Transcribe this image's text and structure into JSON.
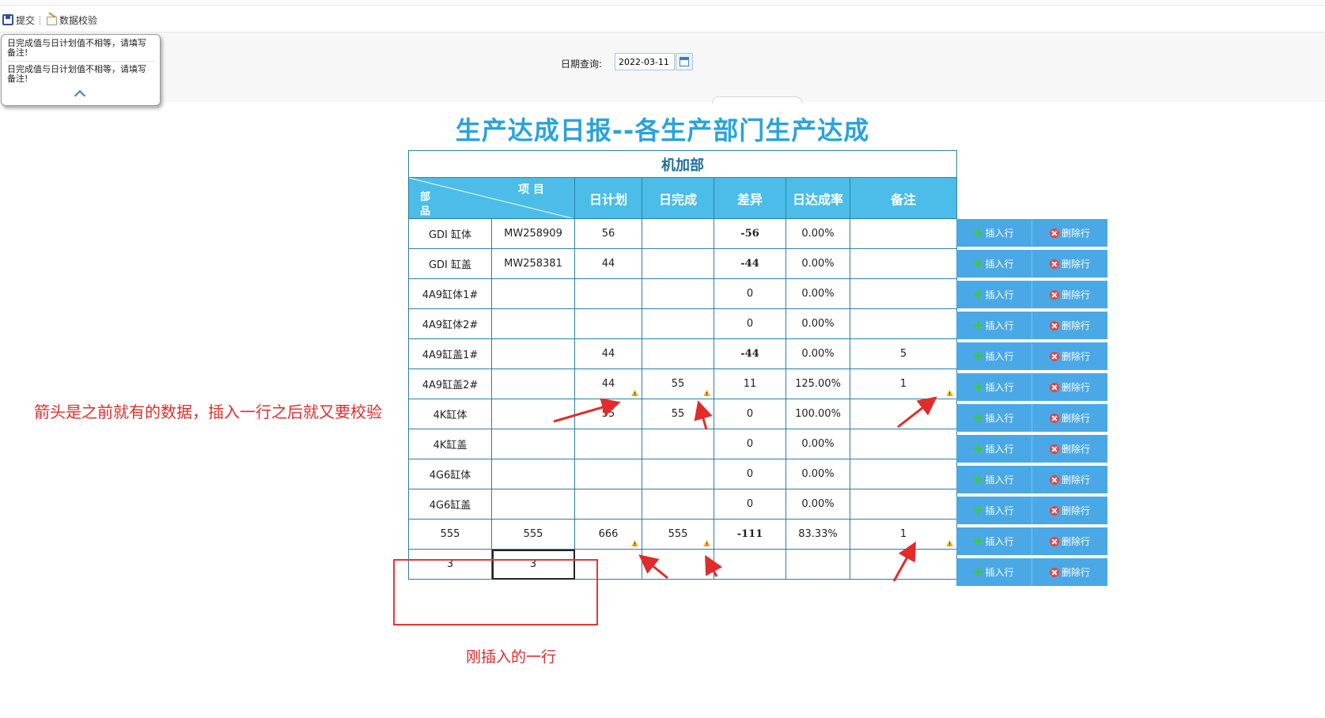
{
  "toolbar": {
    "submit_label": "提交",
    "validate_label": "数据校验"
  },
  "query": {
    "label": "日期查询:",
    "date_value": "2022-03-11"
  },
  "tooltip": {
    "messages": [
      "日完成值与日计划值不相等，请填写备注!",
      "日完成值与日计划值不相等，请填写备注!"
    ]
  },
  "report": {
    "title": "生产达成日报--各生产部门生产达成",
    "department": "机加部",
    "header": {
      "diag_top": "项 目",
      "diag_bottom_1": "部",
      "diag_bottom_2": "品",
      "plan": "日计划",
      "done": "日完成",
      "diff": "差异",
      "rate": "日达成率",
      "remark": "备注"
    },
    "rows": [
      {
        "name": "GDI 缸体",
        "code": "MW258909",
        "plan": "56",
        "done": "",
        "diff": "-56",
        "rate": "0.00%",
        "remark": ""
      },
      {
        "name": "GDI 缸盖",
        "code": "MW258381",
        "plan": "44",
        "done": "",
        "diff": "-44",
        "rate": "0.00%",
        "remark": ""
      },
      {
        "name": "4A9缸体1#",
        "code": "",
        "plan": "",
        "done": "",
        "diff": "0",
        "rate": "0.00%",
        "remark": ""
      },
      {
        "name": "4A9缸体2#",
        "code": "",
        "plan": "",
        "done": "",
        "diff": "0",
        "rate": "0.00%",
        "remark": ""
      },
      {
        "name": "4A9缸盖1#",
        "code": "",
        "plan": "44",
        "done": "",
        "diff": "-44",
        "rate": "0.00%",
        "remark": "5"
      },
      {
        "name": "4A9缸盖2#",
        "code": "",
        "plan": "44",
        "done": "55",
        "diff": "11",
        "rate": "125.00%",
        "remark": "1"
      },
      {
        "name": "4K缸体",
        "code": "",
        "plan": "55",
        "done": "55",
        "diff": "0",
        "rate": "100.00%",
        "remark": ""
      },
      {
        "name": "4K缸盖",
        "code": "",
        "plan": "",
        "done": "",
        "diff": "0",
        "rate": "0.00%",
        "remark": ""
      },
      {
        "name": "4G6缸体",
        "code": "",
        "plan": "",
        "done": "",
        "diff": "0",
        "rate": "0.00%",
        "remark": ""
      },
      {
        "name": "4G6缸盖",
        "code": "",
        "plan": "",
        "done": "",
        "diff": "0",
        "rate": "0.00%",
        "remark": ""
      },
      {
        "name": "555",
        "code": "555",
        "plan": "666",
        "done": "555",
        "diff": "-111",
        "rate": "83.33%",
        "remark": "1"
      },
      {
        "name": "3",
        "code": "3",
        "plan": "",
        "done": "",
        "diff": "",
        "rate": "",
        "remark": ""
      }
    ],
    "insert_label": "插入行",
    "delete_label": "删除行"
  },
  "annotations": {
    "left_note": "箭头是之前就有的数据，插入一行之后就又要校验",
    "bottom_note": "刚插入的一行"
  },
  "colors": {
    "header_bg": "#4bbde8",
    "title": "#2aa3dc",
    "annotation": "#e02c2c",
    "negative": "#e01414",
    "button": "#4aa8e6"
  }
}
